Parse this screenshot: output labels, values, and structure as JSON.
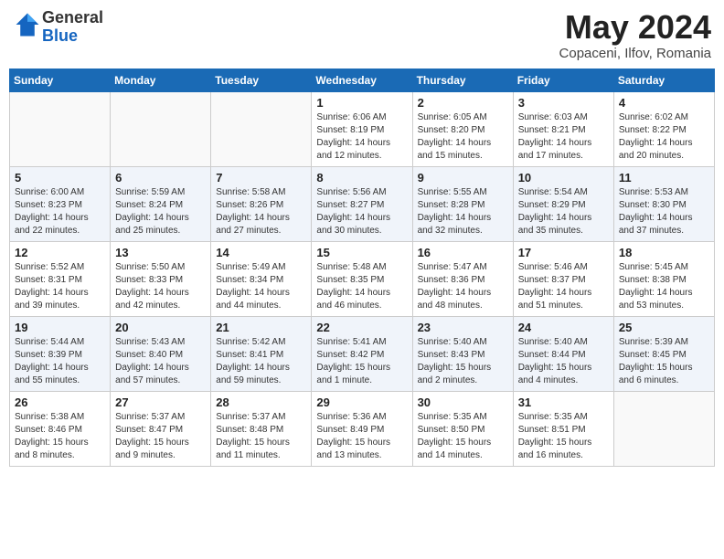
{
  "header": {
    "logo_general": "General",
    "logo_blue": "Blue",
    "month_title": "May 2024",
    "location": "Copaceni, Ilfov, Romania"
  },
  "days_of_week": [
    "Sunday",
    "Monday",
    "Tuesday",
    "Wednesday",
    "Thursday",
    "Friday",
    "Saturday"
  ],
  "weeks": [
    {
      "shade": false,
      "days": [
        {
          "num": "",
          "info": ""
        },
        {
          "num": "",
          "info": ""
        },
        {
          "num": "",
          "info": ""
        },
        {
          "num": "1",
          "info": "Sunrise: 6:06 AM\nSunset: 8:19 PM\nDaylight: 14 hours\nand 12 minutes."
        },
        {
          "num": "2",
          "info": "Sunrise: 6:05 AM\nSunset: 8:20 PM\nDaylight: 14 hours\nand 15 minutes."
        },
        {
          "num": "3",
          "info": "Sunrise: 6:03 AM\nSunset: 8:21 PM\nDaylight: 14 hours\nand 17 minutes."
        },
        {
          "num": "4",
          "info": "Sunrise: 6:02 AM\nSunset: 8:22 PM\nDaylight: 14 hours\nand 20 minutes."
        }
      ]
    },
    {
      "shade": true,
      "days": [
        {
          "num": "5",
          "info": "Sunrise: 6:00 AM\nSunset: 8:23 PM\nDaylight: 14 hours\nand 22 minutes."
        },
        {
          "num": "6",
          "info": "Sunrise: 5:59 AM\nSunset: 8:24 PM\nDaylight: 14 hours\nand 25 minutes."
        },
        {
          "num": "7",
          "info": "Sunrise: 5:58 AM\nSunset: 8:26 PM\nDaylight: 14 hours\nand 27 minutes."
        },
        {
          "num": "8",
          "info": "Sunrise: 5:56 AM\nSunset: 8:27 PM\nDaylight: 14 hours\nand 30 minutes."
        },
        {
          "num": "9",
          "info": "Sunrise: 5:55 AM\nSunset: 8:28 PM\nDaylight: 14 hours\nand 32 minutes."
        },
        {
          "num": "10",
          "info": "Sunrise: 5:54 AM\nSunset: 8:29 PM\nDaylight: 14 hours\nand 35 minutes."
        },
        {
          "num": "11",
          "info": "Sunrise: 5:53 AM\nSunset: 8:30 PM\nDaylight: 14 hours\nand 37 minutes."
        }
      ]
    },
    {
      "shade": false,
      "days": [
        {
          "num": "12",
          "info": "Sunrise: 5:52 AM\nSunset: 8:31 PM\nDaylight: 14 hours\nand 39 minutes."
        },
        {
          "num": "13",
          "info": "Sunrise: 5:50 AM\nSunset: 8:33 PM\nDaylight: 14 hours\nand 42 minutes."
        },
        {
          "num": "14",
          "info": "Sunrise: 5:49 AM\nSunset: 8:34 PM\nDaylight: 14 hours\nand 44 minutes."
        },
        {
          "num": "15",
          "info": "Sunrise: 5:48 AM\nSunset: 8:35 PM\nDaylight: 14 hours\nand 46 minutes."
        },
        {
          "num": "16",
          "info": "Sunrise: 5:47 AM\nSunset: 8:36 PM\nDaylight: 14 hours\nand 48 minutes."
        },
        {
          "num": "17",
          "info": "Sunrise: 5:46 AM\nSunset: 8:37 PM\nDaylight: 14 hours\nand 51 minutes."
        },
        {
          "num": "18",
          "info": "Sunrise: 5:45 AM\nSunset: 8:38 PM\nDaylight: 14 hours\nand 53 minutes."
        }
      ]
    },
    {
      "shade": true,
      "days": [
        {
          "num": "19",
          "info": "Sunrise: 5:44 AM\nSunset: 8:39 PM\nDaylight: 14 hours\nand 55 minutes."
        },
        {
          "num": "20",
          "info": "Sunrise: 5:43 AM\nSunset: 8:40 PM\nDaylight: 14 hours\nand 57 minutes."
        },
        {
          "num": "21",
          "info": "Sunrise: 5:42 AM\nSunset: 8:41 PM\nDaylight: 14 hours\nand 59 minutes."
        },
        {
          "num": "22",
          "info": "Sunrise: 5:41 AM\nSunset: 8:42 PM\nDaylight: 15 hours\nand 1 minute."
        },
        {
          "num": "23",
          "info": "Sunrise: 5:40 AM\nSunset: 8:43 PM\nDaylight: 15 hours\nand 2 minutes."
        },
        {
          "num": "24",
          "info": "Sunrise: 5:40 AM\nSunset: 8:44 PM\nDaylight: 15 hours\nand 4 minutes."
        },
        {
          "num": "25",
          "info": "Sunrise: 5:39 AM\nSunset: 8:45 PM\nDaylight: 15 hours\nand 6 minutes."
        }
      ]
    },
    {
      "shade": false,
      "days": [
        {
          "num": "26",
          "info": "Sunrise: 5:38 AM\nSunset: 8:46 PM\nDaylight: 15 hours\nand 8 minutes."
        },
        {
          "num": "27",
          "info": "Sunrise: 5:37 AM\nSunset: 8:47 PM\nDaylight: 15 hours\nand 9 minutes."
        },
        {
          "num": "28",
          "info": "Sunrise: 5:37 AM\nSunset: 8:48 PM\nDaylight: 15 hours\nand 11 minutes."
        },
        {
          "num": "29",
          "info": "Sunrise: 5:36 AM\nSunset: 8:49 PM\nDaylight: 15 hours\nand 13 minutes."
        },
        {
          "num": "30",
          "info": "Sunrise: 5:35 AM\nSunset: 8:50 PM\nDaylight: 15 hours\nand 14 minutes."
        },
        {
          "num": "31",
          "info": "Sunrise: 5:35 AM\nSunset: 8:51 PM\nDaylight: 15 hours\nand 16 minutes."
        },
        {
          "num": "",
          "info": ""
        }
      ]
    }
  ]
}
